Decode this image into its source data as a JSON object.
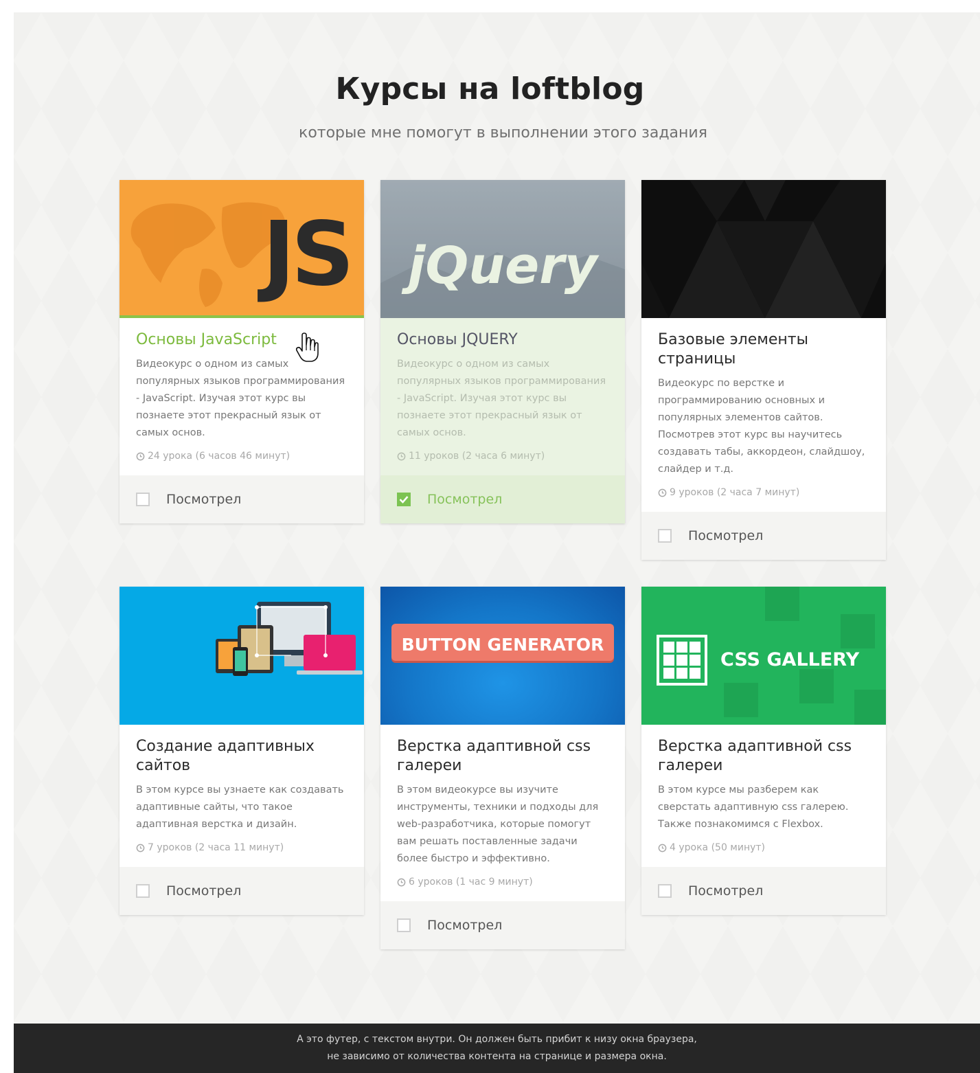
{
  "header": {
    "title": "Курсы на loftblog",
    "subtitle": "которые мне помогут в выполнении этого задания"
  },
  "cards": [
    {
      "title": "Основы JavaScript",
      "description": "Видеокурс о одном из самых популярных языков программирования - JavaScript. Изучая этот курс вы познаете этот прекрасный язык от самых основ.",
      "meta": "24 урока (6 часов 46 минут)",
      "checkbox_label": "Посмотрел",
      "checked": false,
      "thumb_text": "JS",
      "thumb_color": "#f7a23b"
    },
    {
      "title": "Основы JQUERY",
      "description": "Видеокурс о одном из самых популярных языков программирования - JavaScript. Изучая этот курс вы познаете этот прекрасный язык от самых основ.",
      "meta": "11 уроков (2 часа 6 минут)",
      "checkbox_label": "Посмотрел",
      "checked": true,
      "thumb_text": "jQuery",
      "thumb_color": "#7f8e99"
    },
    {
      "title": "Базовые элементы страницы",
      "description": "Видеокурс по верстке и программированию основных и популярных элементов сайтов. Посмотрев этот курс вы научитесь создавать табы, аккордеон, слайдшоу, слайдер и т.д.",
      "meta": "9 уроков (2 часа 7 минут)",
      "checkbox_label": "Посмотрел",
      "checked": false,
      "thumb_color": "#0e0e0e"
    },
    {
      "title": "Создание адаптивных сайтов",
      "description": "В этом курсе вы узнаете как создавать адаптивные сайты, что такое адаптивная верстка и дизайн.",
      "meta": "7 уроков (2 часа 11 минут)",
      "checkbox_label": "Посмотрел",
      "checked": false,
      "thumb_color": "#05a9e6"
    },
    {
      "title": "Верстка адаптивной css галереи",
      "description": "В этом видеокурсе вы изучите инструменты, техники и подходы для web-разработчика, которые помогут вам решать поставленные задачи более быстро и эффективно.",
      "meta": "6 уроков (1 час 9 минут)",
      "checkbox_label": "Посмотрел",
      "checked": false,
      "thumb_text": "BUTTON GENERATOR",
      "thumb_color": "#1476c8"
    },
    {
      "title": "Верстка адаптивной css галереи",
      "description": "В этом курсе мы разберем как сверстать адаптивную css галерею. Также познакомимся с Flexbox.",
      "meta": "4 урока (50 минут)",
      "checkbox_label": "Посмотрел",
      "checked": false,
      "thumb_text": "CSS GALLERY",
      "thumb_color": "#22b45c"
    }
  ],
  "footer": {
    "line1": "А это футер, с текстом внутри. Он должен быть прибит к низу окна браузера,",
    "line2": "не зависимо от количества контента на странице и размера окна."
  }
}
